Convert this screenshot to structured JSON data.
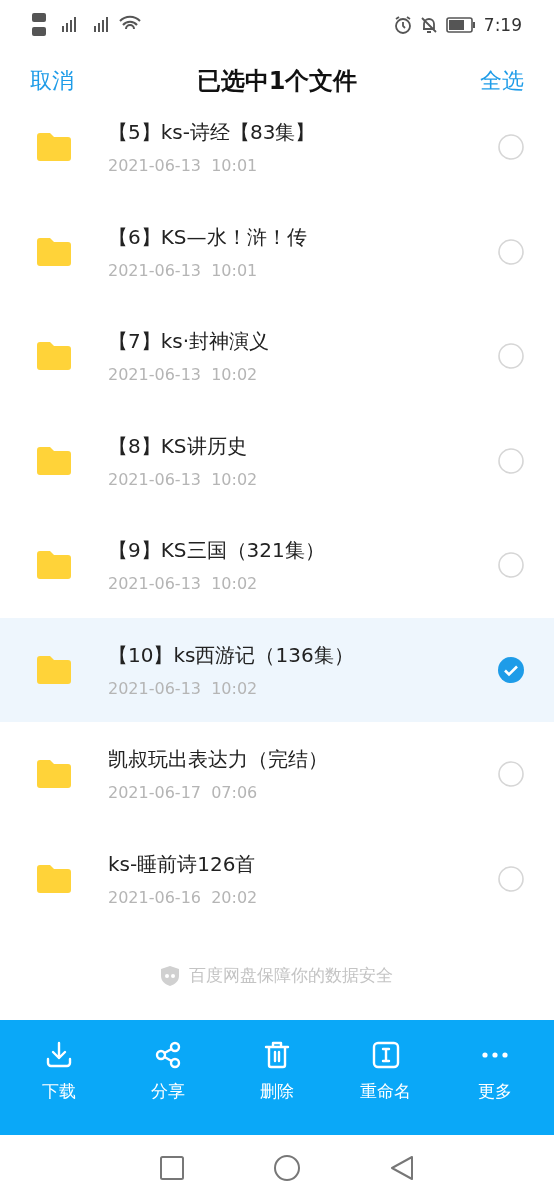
{
  "status_bar": {
    "time": "7:19"
  },
  "header": {
    "cancel": "取消",
    "title": "已选中1个文件",
    "select_all": "全选"
  },
  "files": [
    {
      "name": "【5】ks-诗经【83集】",
      "date": "2021-06-13  10:01",
      "selected": false
    },
    {
      "name": "【6】KS—水！浒！传",
      "date": "2021-06-13  10:01",
      "selected": false
    },
    {
      "name": "【7】ks·封神演义",
      "date": "2021-06-13  10:02",
      "selected": false
    },
    {
      "name": "【8】KS讲历史",
      "date": "2021-06-13  10:02",
      "selected": false
    },
    {
      "name": "【9】KS三国（321集）",
      "date": "2021-06-13  10:02",
      "selected": false
    },
    {
      "name": "【10】ks西游记（136集）",
      "date": "2021-06-13  10:02",
      "selected": true
    },
    {
      "name": "凯叔玩出表达力（完结）",
      "date": "2021-06-17  07:06",
      "selected": false
    },
    {
      "name": "ks-睡前诗126首",
      "date": "2021-06-16  20:02",
      "selected": false
    }
  ],
  "security_note": "百度网盘保障你的数据安全",
  "actions": [
    {
      "kind": "download",
      "label": "下载"
    },
    {
      "kind": "share",
      "label": "分享"
    },
    {
      "kind": "delete",
      "label": "删除"
    },
    {
      "kind": "rename",
      "label": "重命名"
    },
    {
      "kind": "more",
      "label": "更多"
    }
  ]
}
